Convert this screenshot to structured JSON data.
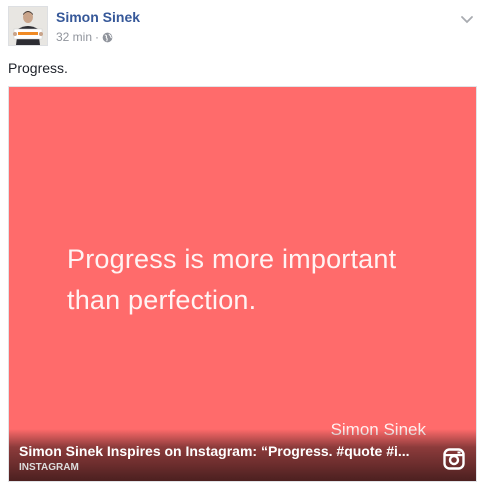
{
  "post": {
    "author": "Simon Sinek",
    "timestamp": "32 min",
    "separator": "·",
    "audience_icon": "globe-icon",
    "caption": "Progress.",
    "menu_icon": "chevron-down-icon"
  },
  "attachment": {
    "quote_text": "Progress is more important than perfection.",
    "quote_signature": "Simon Sinek",
    "title": "Simon Sinek Inspires on Instagram: “Progress. #quote #i...",
    "source": "INSTAGRAM",
    "source_icon": "instagram-icon",
    "card_color": "#ff6b6b"
  },
  "colors": {
    "author_link": "#365899",
    "meta": "#90949c",
    "text": "#1d2129"
  }
}
